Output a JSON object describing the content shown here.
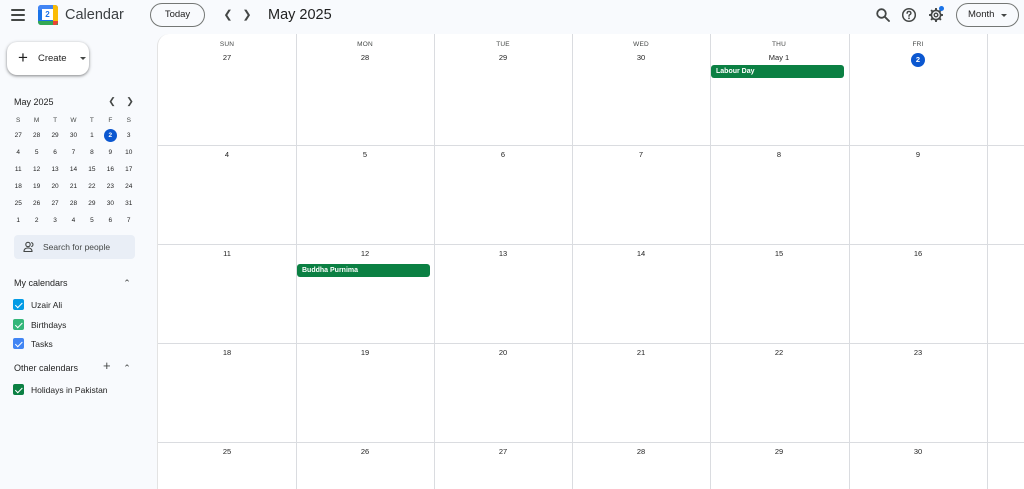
{
  "header": {
    "menu_icon": "hamburger-menu-icon",
    "logo_day": "2",
    "app_title": "Calendar",
    "today_label": "Today",
    "prev_icon": "chevron-left-icon",
    "next_icon": "chevron-right-icon",
    "current_period": "May 2025",
    "search_icon": "search-icon",
    "help_icon": "help-icon",
    "settings_icon": "gear-icon",
    "view_label": "Month"
  },
  "sidebar": {
    "create_label": "Create",
    "mini_calendar": {
      "title": "May 2025",
      "weekday_heads": [
        "S",
        "M",
        "T",
        "W",
        "T",
        "F",
        "S"
      ],
      "weeks": [
        [
          "27",
          "28",
          "29",
          "30",
          "1",
          "2",
          "3"
        ],
        [
          "4",
          "5",
          "6",
          "7",
          "8",
          "9",
          "10"
        ],
        [
          "11",
          "12",
          "13",
          "14",
          "15",
          "16",
          "17"
        ],
        [
          "18",
          "19",
          "20",
          "21",
          "22",
          "23",
          "24"
        ],
        [
          "25",
          "26",
          "27",
          "28",
          "29",
          "30",
          "31"
        ],
        [
          "1",
          "2",
          "3",
          "4",
          "5",
          "6",
          "7"
        ]
      ],
      "today": "2"
    },
    "people_search_placeholder": "Search for people",
    "my_calendars": {
      "title": "My calendars",
      "items": [
        {
          "name": "Uzair Ali",
          "color": "#039be5"
        },
        {
          "name": "Birthdays",
          "color": "#33b679"
        },
        {
          "name": "Tasks",
          "color": "#4285f4"
        }
      ]
    },
    "other_calendars": {
      "title": "Other calendars",
      "items": [
        {
          "name": "Holidays in Pakistan",
          "color": "#0b8043"
        }
      ]
    }
  },
  "month_view": {
    "weekdays": [
      "SUN",
      "MON",
      "TUE",
      "WED",
      "THU",
      "FRI"
    ],
    "weeks": [
      [
        "27",
        "28",
        "29",
        "30",
        "May 1",
        "2"
      ],
      [
        "4",
        "5",
        "6",
        "7",
        "8",
        "9"
      ],
      [
        "11",
        "12",
        "13",
        "14",
        "15",
        "16"
      ],
      [
        "18",
        "19",
        "20",
        "21",
        "22",
        "23"
      ],
      [
        "25",
        "26",
        "27",
        "28",
        "29",
        "30"
      ]
    ],
    "today": "2",
    "events": [
      {
        "title": "Labour Day",
        "color": "#0b8043"
      },
      {
        "title": "Buddha Purnima",
        "color": "#0b8043"
      }
    ]
  }
}
